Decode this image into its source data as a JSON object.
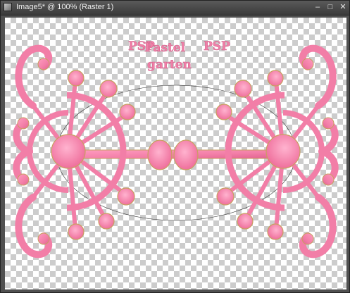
{
  "window": {
    "title": "Image5* @ 100% (Raster 1)",
    "controls": {
      "minimize": "–",
      "maximize": "□",
      "close": "✕"
    }
  },
  "canvas": {
    "watermark": {
      "line1": "Pastel",
      "line2": "garten",
      "monogram": "PSP"
    }
  },
  "colors": {
    "ornament_pink": "#f27ea7",
    "ornament_light": "#ffa3c4",
    "outline_gold": "#c8a060",
    "checker_light": "#ffffff",
    "checker_dark": "#cccccc"
  }
}
